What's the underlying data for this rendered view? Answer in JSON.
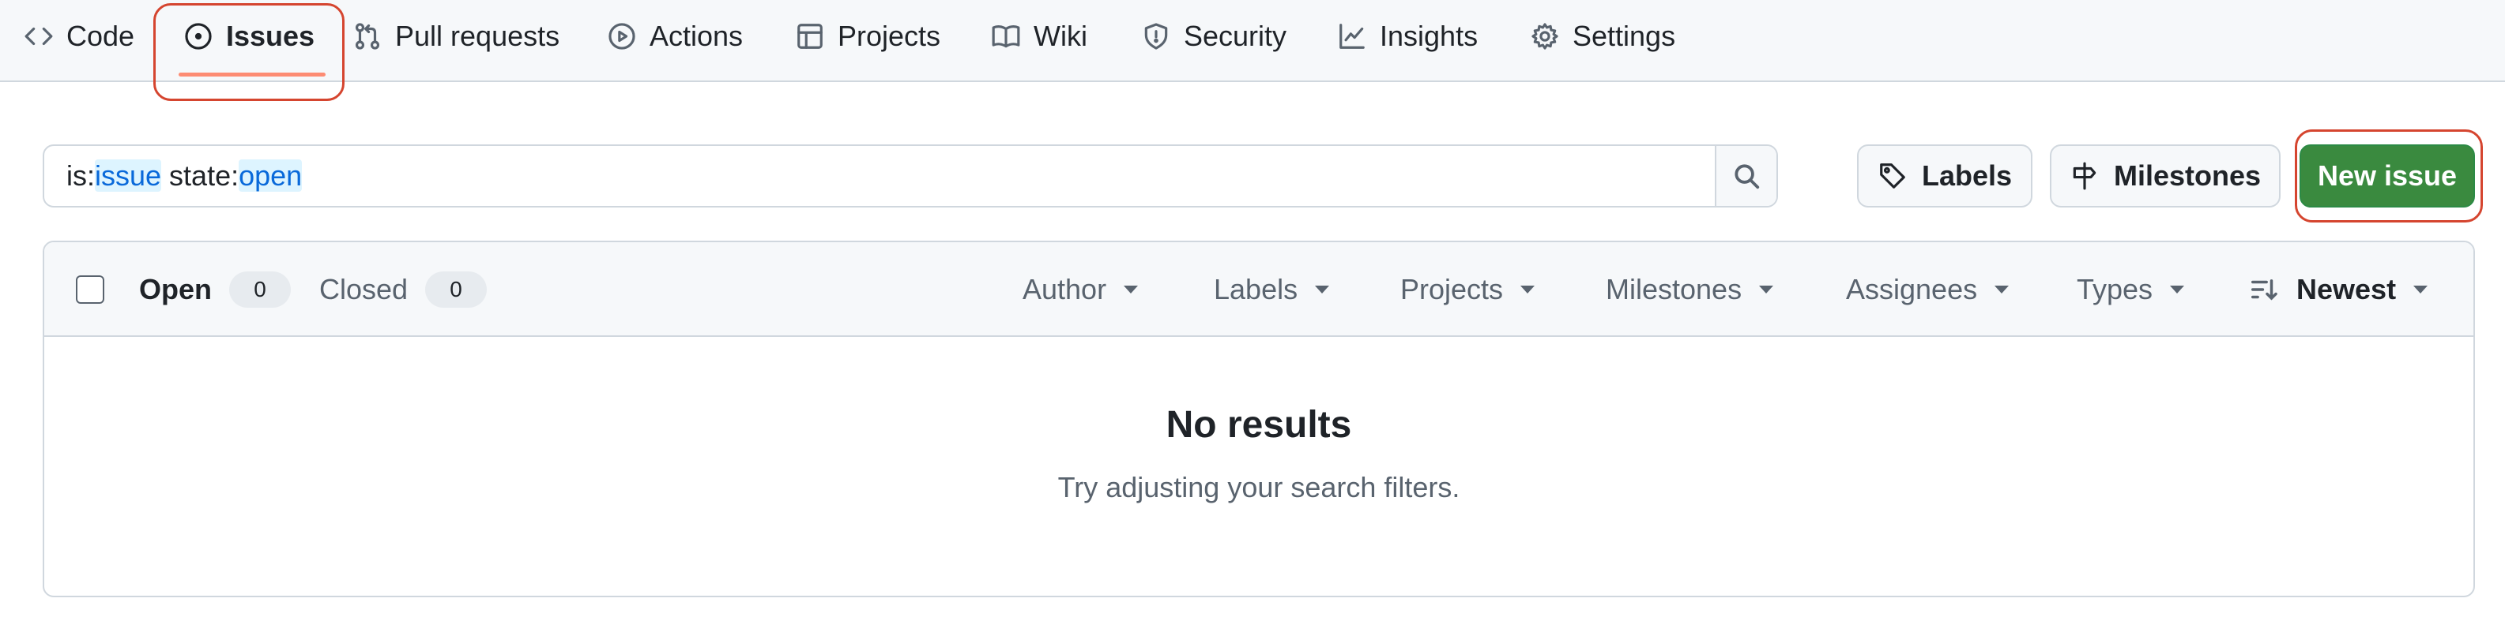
{
  "repo_nav": {
    "items": [
      {
        "label": "Code",
        "icon": "code-icon"
      },
      {
        "label": "Issues",
        "icon": "issue-opened-icon",
        "active": true
      },
      {
        "label": "Pull requests",
        "icon": "git-pull-request-icon"
      },
      {
        "label": "Actions",
        "icon": "play-icon"
      },
      {
        "label": "Projects",
        "icon": "table-icon"
      },
      {
        "label": "Wiki",
        "icon": "book-icon"
      },
      {
        "label": "Security",
        "icon": "shield-icon"
      },
      {
        "label": "Insights",
        "icon": "graph-icon"
      },
      {
        "label": "Settings",
        "icon": "gear-icon"
      }
    ]
  },
  "search": {
    "q1_key": "is:",
    "q1_val": "issue",
    "q2_key": " state:",
    "q2_val": "open"
  },
  "actions": {
    "labels": "Labels",
    "milestones": "Milestones",
    "new_issue": "New issue"
  },
  "list_header": {
    "open_label": "Open",
    "open_count": "0",
    "closed_label": "Closed",
    "closed_count": "0",
    "filters": [
      "Author",
      "Labels",
      "Projects",
      "Milestones",
      "Assignees",
      "Types"
    ],
    "sort": "Newest"
  },
  "empty_state": {
    "title": "No results",
    "subtitle": "Try adjusting your search filters."
  },
  "colors": {
    "primary_button": "#3a8a3f",
    "active_underline": "#fd8c73",
    "highlight": "#d5452f",
    "link": "#0969da"
  }
}
